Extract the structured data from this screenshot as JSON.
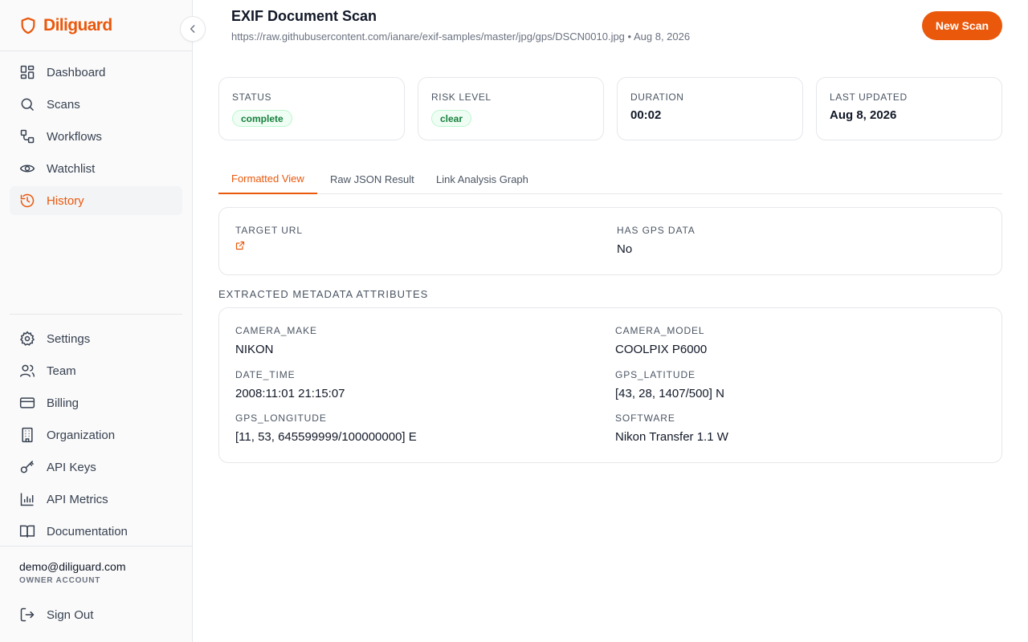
{
  "app": {
    "name": "Diliguard"
  },
  "sidebar": {
    "main_items": [
      {
        "label": "Dashboard",
        "icon": "grid-icon"
      },
      {
        "label": "Scans",
        "icon": "search-icon"
      },
      {
        "label": "Workflows",
        "icon": "workflow-icon"
      },
      {
        "label": "Watchlist",
        "icon": "eye-icon"
      },
      {
        "label": "History",
        "icon": "history-icon",
        "active": true
      }
    ],
    "bottom_items": [
      {
        "label": "Settings",
        "icon": "gear-icon"
      },
      {
        "label": "Team",
        "icon": "users-icon"
      },
      {
        "label": "Billing",
        "icon": "credit-card-icon"
      },
      {
        "label": "Organization",
        "icon": "building-icon"
      },
      {
        "label": "API Keys",
        "icon": "key-icon"
      },
      {
        "label": "API Metrics",
        "icon": "bar-chart-icon"
      },
      {
        "label": "Documentation",
        "icon": "book-icon"
      }
    ],
    "user": {
      "email": "demo@diliguard.com",
      "role": "OWNER ACCOUNT"
    },
    "sign_out": "Sign Out"
  },
  "header": {
    "title": "EXIF Document Scan",
    "subtitle": "https://raw.githubusercontent.com/ianare/exif-samples/master/jpg/gps/DSCN0010.jpg • Aug 8, 2026",
    "new_scan_label": "New Scan"
  },
  "stats": {
    "status": {
      "label": "STATUS",
      "value": "complete"
    },
    "risk": {
      "label": "RISK LEVEL",
      "value": "clear"
    },
    "duration": {
      "label": "DURATION",
      "value": "00:02"
    },
    "updated": {
      "label": "LAST UPDATED",
      "value": "Aug 8, 2026"
    }
  },
  "tabs": [
    "Formatted View",
    "Raw JSON Result",
    "Link Analysis Graph"
  ],
  "summary": {
    "target_url_label": "TARGET URL",
    "gps_label": "HAS GPS DATA",
    "gps_value": "No"
  },
  "metadata": {
    "section_title": "EXTRACTED METADATA ATTRIBUTES",
    "items": [
      {
        "key": "CAMERA_MAKE",
        "value": "NIKON"
      },
      {
        "key": "CAMERA_MODEL",
        "value": "COOLPIX P6000"
      },
      {
        "key": "DATE_TIME",
        "value": "2008:11:01 21:15:07"
      },
      {
        "key": "GPS_LATITUDE",
        "value": "[43, 28, 1407/500] N"
      },
      {
        "key": "GPS_LONGITUDE",
        "value": "[11, 53, 645599999/100000000] E"
      },
      {
        "key": "SOFTWARE",
        "value": "Nikon Transfer 1.1 W"
      }
    ]
  },
  "colors": {
    "accent": "#ea580c",
    "success": "#15803d",
    "border": "#e5e7eb"
  }
}
